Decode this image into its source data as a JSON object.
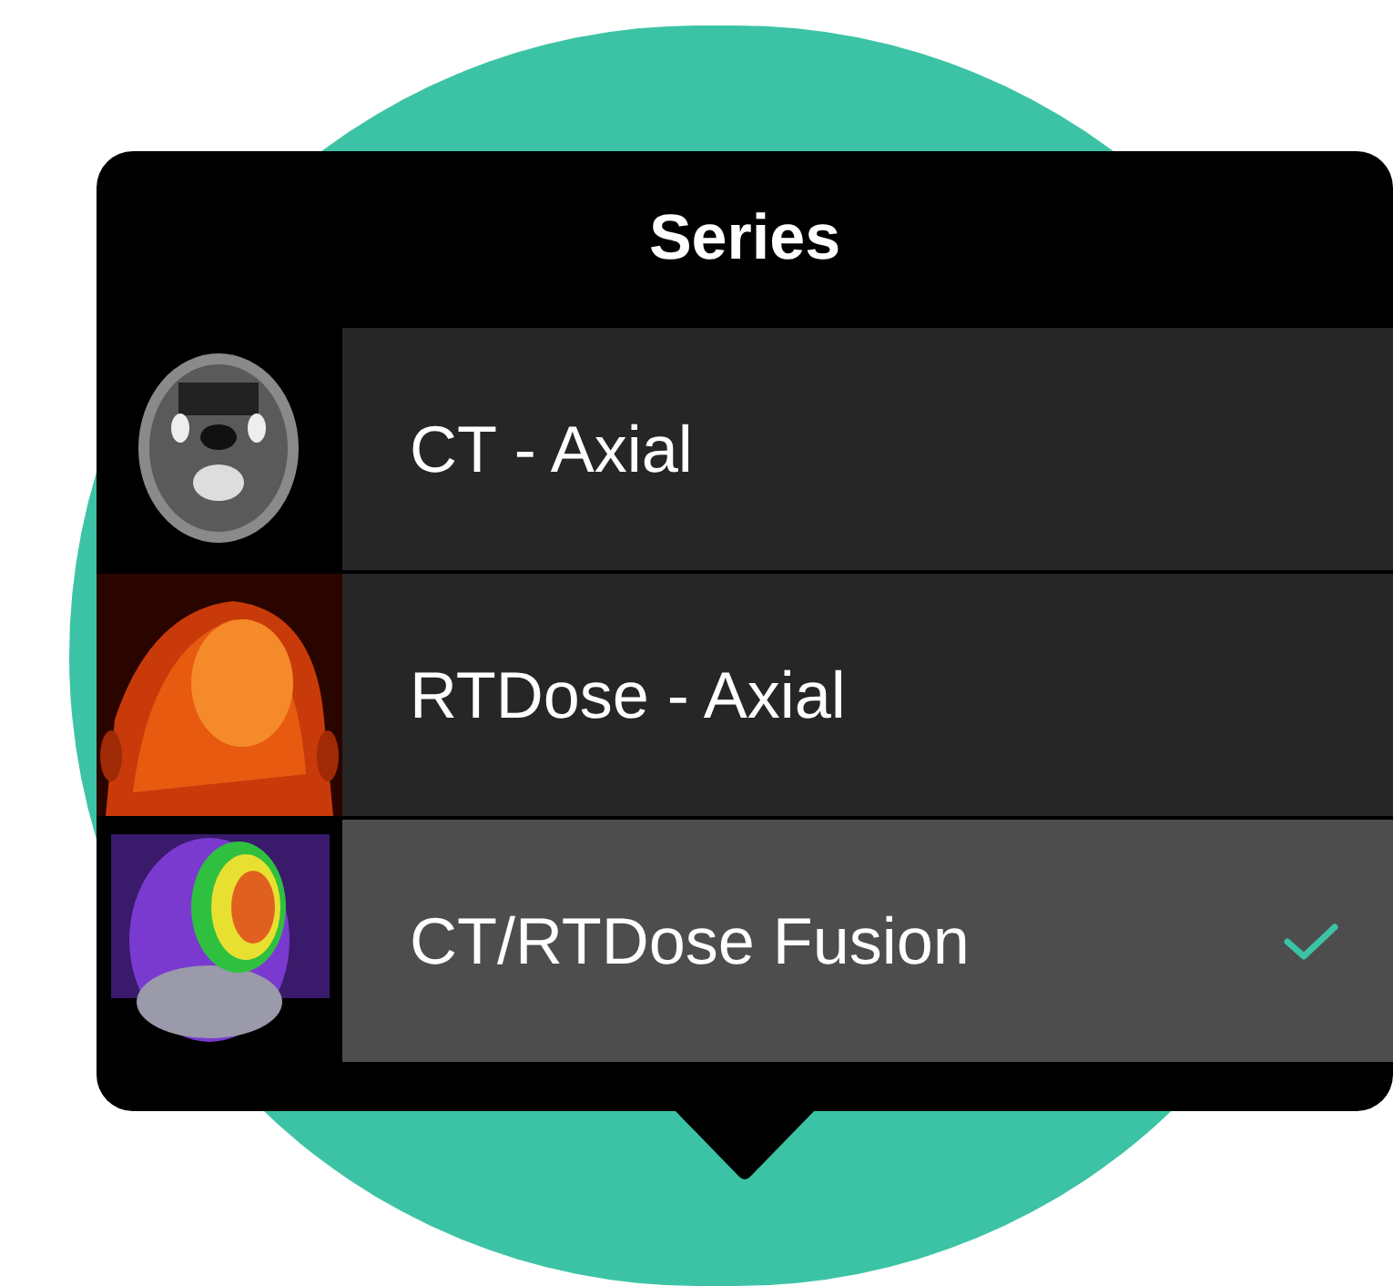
{
  "popover": {
    "title": "Series"
  },
  "series": [
    {
      "label": "CT - Axial",
      "selected": false
    },
    {
      "label": "RTDose - Axial",
      "selected": false
    },
    {
      "label": "CT/RTDose Fusion",
      "selected": true
    }
  ]
}
